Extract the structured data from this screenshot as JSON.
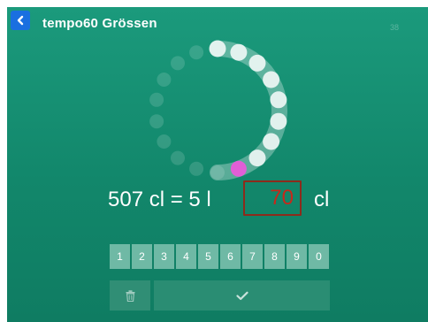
{
  "header": {
    "title": "tempo60 Grössen",
    "counter": "38",
    "back_icon": "chevron-left-icon"
  },
  "progress_ring": {
    "total_steps": 18,
    "highlight_step": 8
  },
  "equation": {
    "left_side": "507 cl = 5 l",
    "answer_value": "70",
    "unit": "cl"
  },
  "keypad": {
    "keys": [
      "1",
      "2",
      "3",
      "4",
      "5",
      "6",
      "7",
      "8",
      "9",
      "0"
    ]
  },
  "actions": {
    "delete_icon": "trash-icon",
    "confirm_icon": "checkmark-icon"
  },
  "colors": {
    "background": "#15917",
    "answer_text": "#c8281a",
    "answer_border": "#8c2b1c",
    "ring_highlight": "#e05fd6",
    "back_button": "#1a6fe0"
  }
}
